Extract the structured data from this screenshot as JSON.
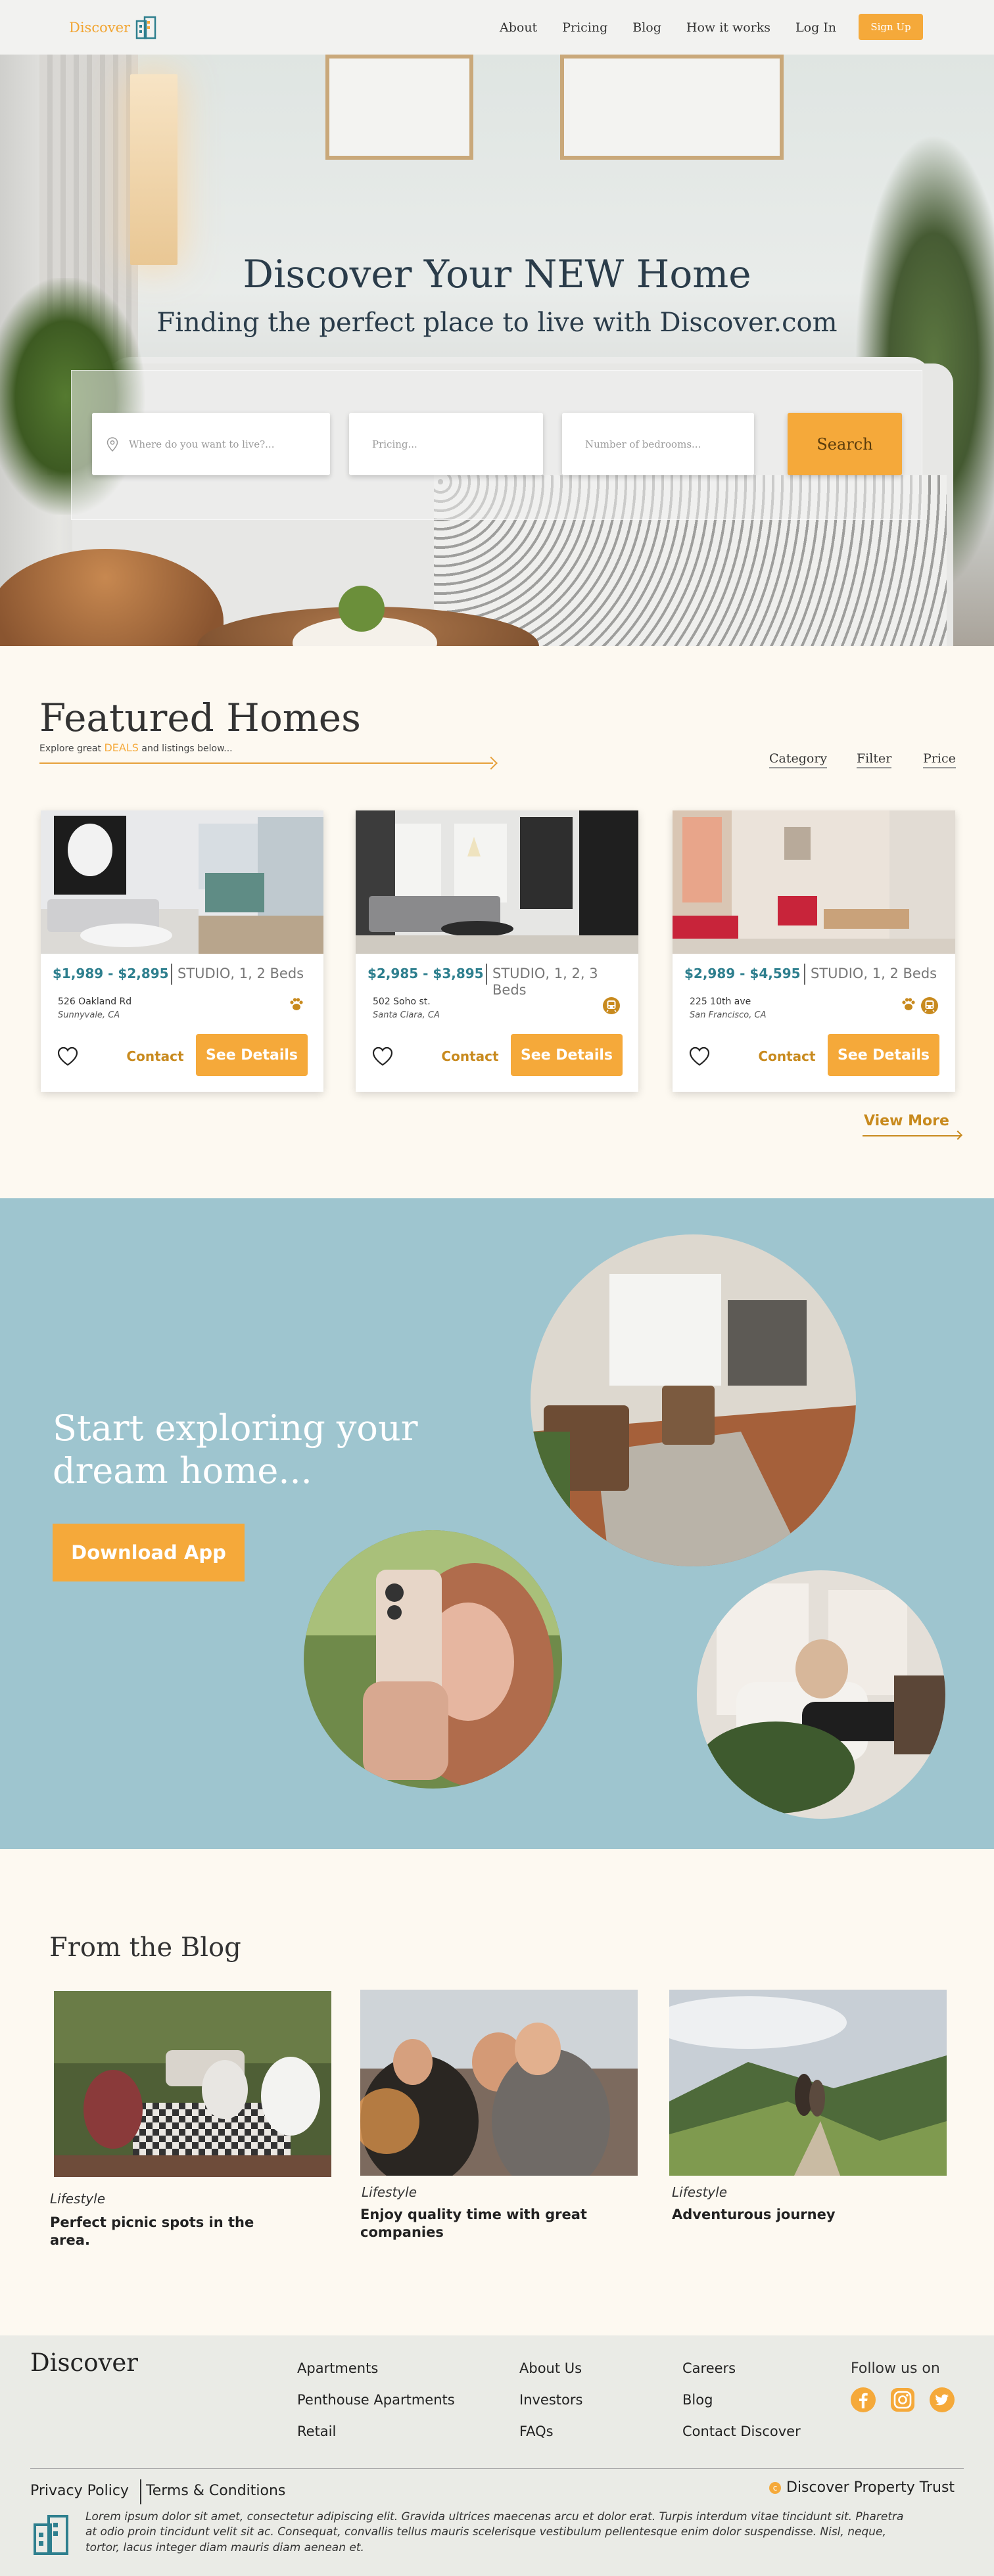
{
  "nav": {
    "brand": "Discover",
    "links": [
      "About",
      "Pricing",
      "Blog",
      "How it works",
      "Log In"
    ],
    "signup": "Sign Up"
  },
  "hero": {
    "title": "Discover Your NEW Home",
    "subtitle": "Finding the perfect place to live with Discover.com",
    "location_placeholder": "Where do you want to live?...",
    "pricing_placeholder": "Pricing...",
    "bedrooms_placeholder": "Number of bedrooms...",
    "search_label": "Search"
  },
  "featured": {
    "title": "Featured Homes",
    "subtitle_pre": "Explore great",
    "subtitle_deals": "DEALS",
    "subtitle_post": "and listings below...",
    "tabs": [
      "Category",
      "Filter",
      "Price"
    ],
    "view_more": "View More",
    "contact_label": "Contact",
    "details_label": "See Details",
    "listings": [
      {
        "price": "$1,989 - $2,895",
        "beds": "STUDIO, 1, 2 Beds",
        "street": "526 Oakland Rd",
        "city": "Sunnyvale, CA",
        "amenities": [
          "paw-icon"
        ]
      },
      {
        "price": "$2,985 - $3,895",
        "beds": "STUDIO, 1, 2, 3 Beds",
        "street": "502 Soho st.",
        "city": "Santa Clara, CA",
        "amenities": [
          "train-icon"
        ]
      },
      {
        "price": "$2,989 - $4,595",
        "beds": "STUDIO, 1, 2 Beds",
        "street": "225 10th ave",
        "city": "San Francisco, CA",
        "amenities": [
          "paw-icon",
          "train-icon"
        ]
      }
    ]
  },
  "explore": {
    "title": "Start exploring your dream home...",
    "download_label": "Download App"
  },
  "blog": {
    "title": "From the Blog",
    "posts": [
      {
        "category": "Lifestyle",
        "title": "Perfect picnic spots in the area."
      },
      {
        "category": "Lifestyle",
        "title": "Enjoy quality time with great companies"
      },
      {
        "category": "Lifestyle",
        "title": "Adventurous journey"
      }
    ]
  },
  "footer": {
    "brand": "Discover",
    "col1": [
      "Apartments",
      "Penthouse Apartments",
      "Retail"
    ],
    "col2": [
      "About Us",
      "Investors",
      "FAQs"
    ],
    "col3": [
      "Careers",
      "Blog",
      "Contact Discover"
    ],
    "follow": "Follow us on",
    "social": [
      "facebook-icon",
      "instagram-icon",
      "twitter-icon"
    ],
    "privacy": "Privacy Policy",
    "terms": "Terms & Conditions",
    "trust_mark": "c",
    "trust": "Discover Property Trust",
    "lorem": "Lorem ipsum dolor sit amet, consectetur adipiscing elit. Gravida ultrices maecenas arcu et dolor erat. Turpis interdum vitae tincidunt sit. Pharetra at odio proin tincidunt velit sit ac. Consequat, convallis tellus mauris scelerisque vestibulum pellentesque enim dolor suspendisse. Nisl, neque, tortor, lacus integer diam mauris diam aenean et."
  },
  "colors": {
    "accent": "#f5a93a",
    "teal": "#2e7f8e",
    "explore_bg": "#9ec5cf",
    "cream": "#fdf9f1"
  }
}
